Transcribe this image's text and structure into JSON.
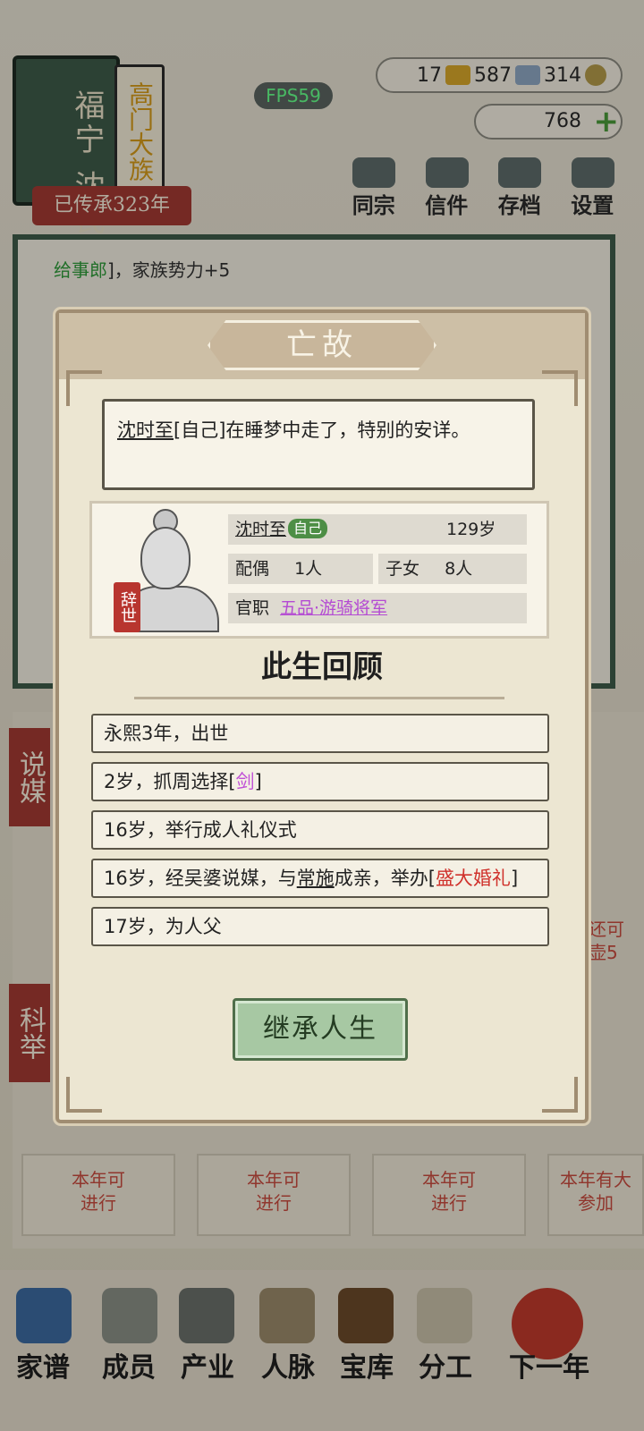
{
  "header": {
    "family_book_title": "福宁 沈氏",
    "family_rank": "高门大族",
    "inherit_label": "已传承323年",
    "fps": "FPS59",
    "resources": {
      "jade": "17",
      "silver": "587",
      "coin": "314"
    },
    "gold": "768",
    "buttons": [
      "同宗",
      "信件",
      "存档",
      "设置"
    ]
  },
  "background_log": {
    "line1_green": "给事郎",
    "line1_rest": "]，家族势力+5"
  },
  "side_tags": [
    "说媒",
    "科举"
  ],
  "cards": [
    {
      "label": "本年可\n进行"
    },
    {
      "label": "本年可\n进行"
    },
    {
      "label": "本年可\n进行"
    },
    {
      "label": "本年有大\n参加"
    }
  ],
  "side_note": "还可\n壶5",
  "bottom_nav": [
    "家谱",
    "成员",
    "产业",
    "人脉",
    "宝库",
    "分工",
    "下一年"
  ],
  "dialog": {
    "title": "亡故",
    "message_name": "沈时至",
    "message_rest": "[自己]在睡梦中走了，特别的安详。",
    "profile": {
      "name": "沈时至",
      "self_badge": "自己",
      "age": "129岁",
      "spouse_label": "配偶",
      "spouse_value": "1人",
      "children_label": "子女",
      "children_value": "8人",
      "office_label": "官职",
      "office_value": "五品·游骑将军",
      "retire_stamp": "辞世"
    },
    "review_title": "此生回顾",
    "review": {
      "item1": "永熙3年，出世",
      "item2_a": "2岁，抓周选择[",
      "item2_b": "剑",
      "item2_c": "]",
      "item3": "16岁，举行成人礼仪式",
      "item4_a": "16岁，经吴婆说媒，与",
      "item4_b": "常施",
      "item4_c": "成亲，举办[",
      "item4_d": "盛大婚礼",
      "item4_e": "]",
      "item5": "17岁，为人父"
    },
    "inherit_button": "继承人生"
  }
}
